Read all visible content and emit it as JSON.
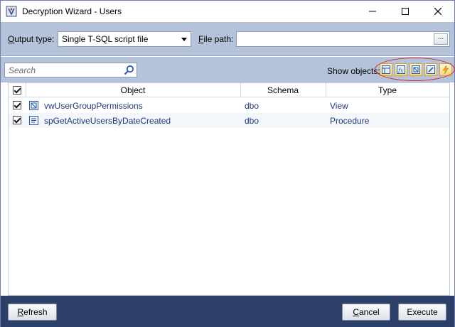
{
  "window": {
    "title": "Decryption Wizard - Users"
  },
  "toolbar": {
    "output_type_label_prefix": "",
    "output_type_label_underlined": "O",
    "output_type_label_rest": "utput type:",
    "output_type_value": "Single T-SQL script file",
    "file_path_label_underlined": "F",
    "file_path_label_rest": "ile path:",
    "file_path_value": "",
    "browse_label": "..."
  },
  "filter": {
    "search_placeholder": "Search",
    "show_objects_label": "Show objects:",
    "object_type_buttons": [
      "table-icon",
      "function-icon",
      "view-icon",
      "procedure-icon",
      "trigger-icon"
    ]
  },
  "grid": {
    "columns": [
      "Object",
      "Schema",
      "Type"
    ],
    "rows": [
      {
        "checked": true,
        "object": "vwUserGroupPermissions",
        "schema": "dbo",
        "type": "View",
        "icon": "view-icon"
      },
      {
        "checked": true,
        "object": "spGetActiveUsersByDateCreated",
        "schema": "dbo",
        "type": "Procedure",
        "icon": "procedure-icon"
      }
    ]
  },
  "footer": {
    "refresh_underlined": "R",
    "refresh_rest": "efresh",
    "cancel_prefix": "",
    "cancel_underlined": "C",
    "cancel_rest": "ancel",
    "execute_label": "Execute"
  },
  "colors": {
    "panel": "#b4c3d9",
    "footer": "#2b3f68",
    "highlight_ellipse": "#d8222a",
    "link_text": "#1f3a7a"
  }
}
